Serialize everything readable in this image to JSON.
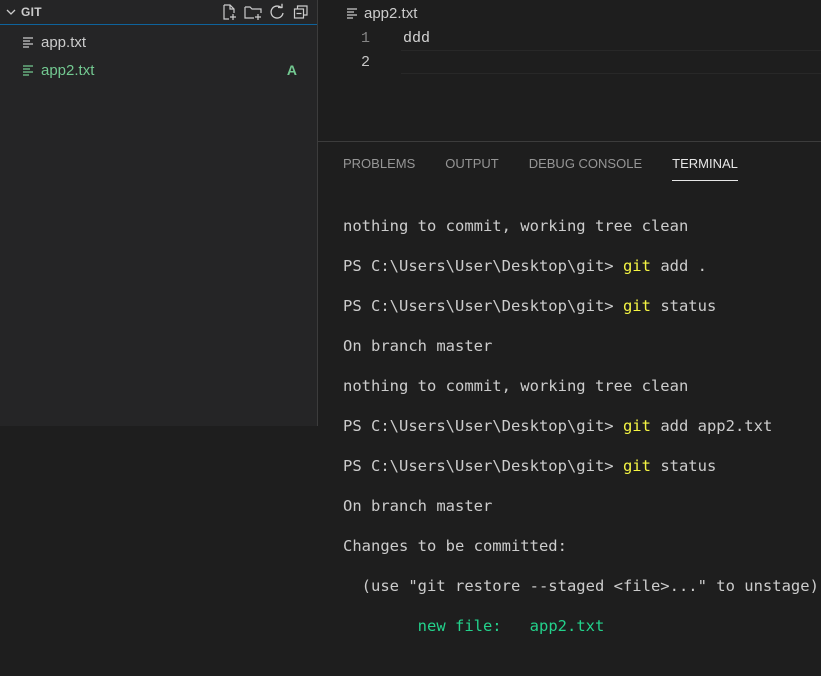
{
  "sidebar": {
    "title": "GIT",
    "actions": [
      "new-file-icon",
      "new-folder-icon",
      "refresh-icon",
      "collapse-all-icon"
    ],
    "files": [
      {
        "name": "app.txt",
        "status": ""
      },
      {
        "name": "app2.txt",
        "status": "A"
      }
    ]
  },
  "editor": {
    "tab": "app2.txt",
    "lines": [
      {
        "num": "1",
        "text": "ddd"
      },
      {
        "num": "2",
        "text": ""
      }
    ]
  },
  "panel": {
    "tabs": [
      "PROBLEMS",
      "OUTPUT",
      "DEBUG CONSOLE",
      "TERMINAL"
    ],
    "active_tab": "TERMINAL"
  },
  "terminal": {
    "prompt": "PS C:\\Users\\User\\Desktop\\git>",
    "lines": [
      {
        "text": "nothing to commit, working tree clean"
      },
      {
        "cmd": "git",
        "args": "add ."
      },
      {
        "cmd": "git",
        "args": "status"
      },
      {
        "text": "On branch master"
      },
      {
        "text": "nothing to commit, working tree clean"
      },
      {
        "cmd": "git",
        "args": "add app2.txt"
      },
      {
        "cmd": "git",
        "args": "status"
      },
      {
        "text": "On branch master"
      },
      {
        "text": "Changes to be committed:"
      },
      {
        "text": "  (use \"git restore --staged <file>...\" to unstage)"
      },
      {
        "green_label": "new file:",
        "green_value": "app2.txt"
      }
    ]
  },
  "colors": {
    "added": "#73c991",
    "terminal_command": "#f5f543",
    "terminal_green": "#23d18b",
    "focus_border": "#0e639c"
  }
}
